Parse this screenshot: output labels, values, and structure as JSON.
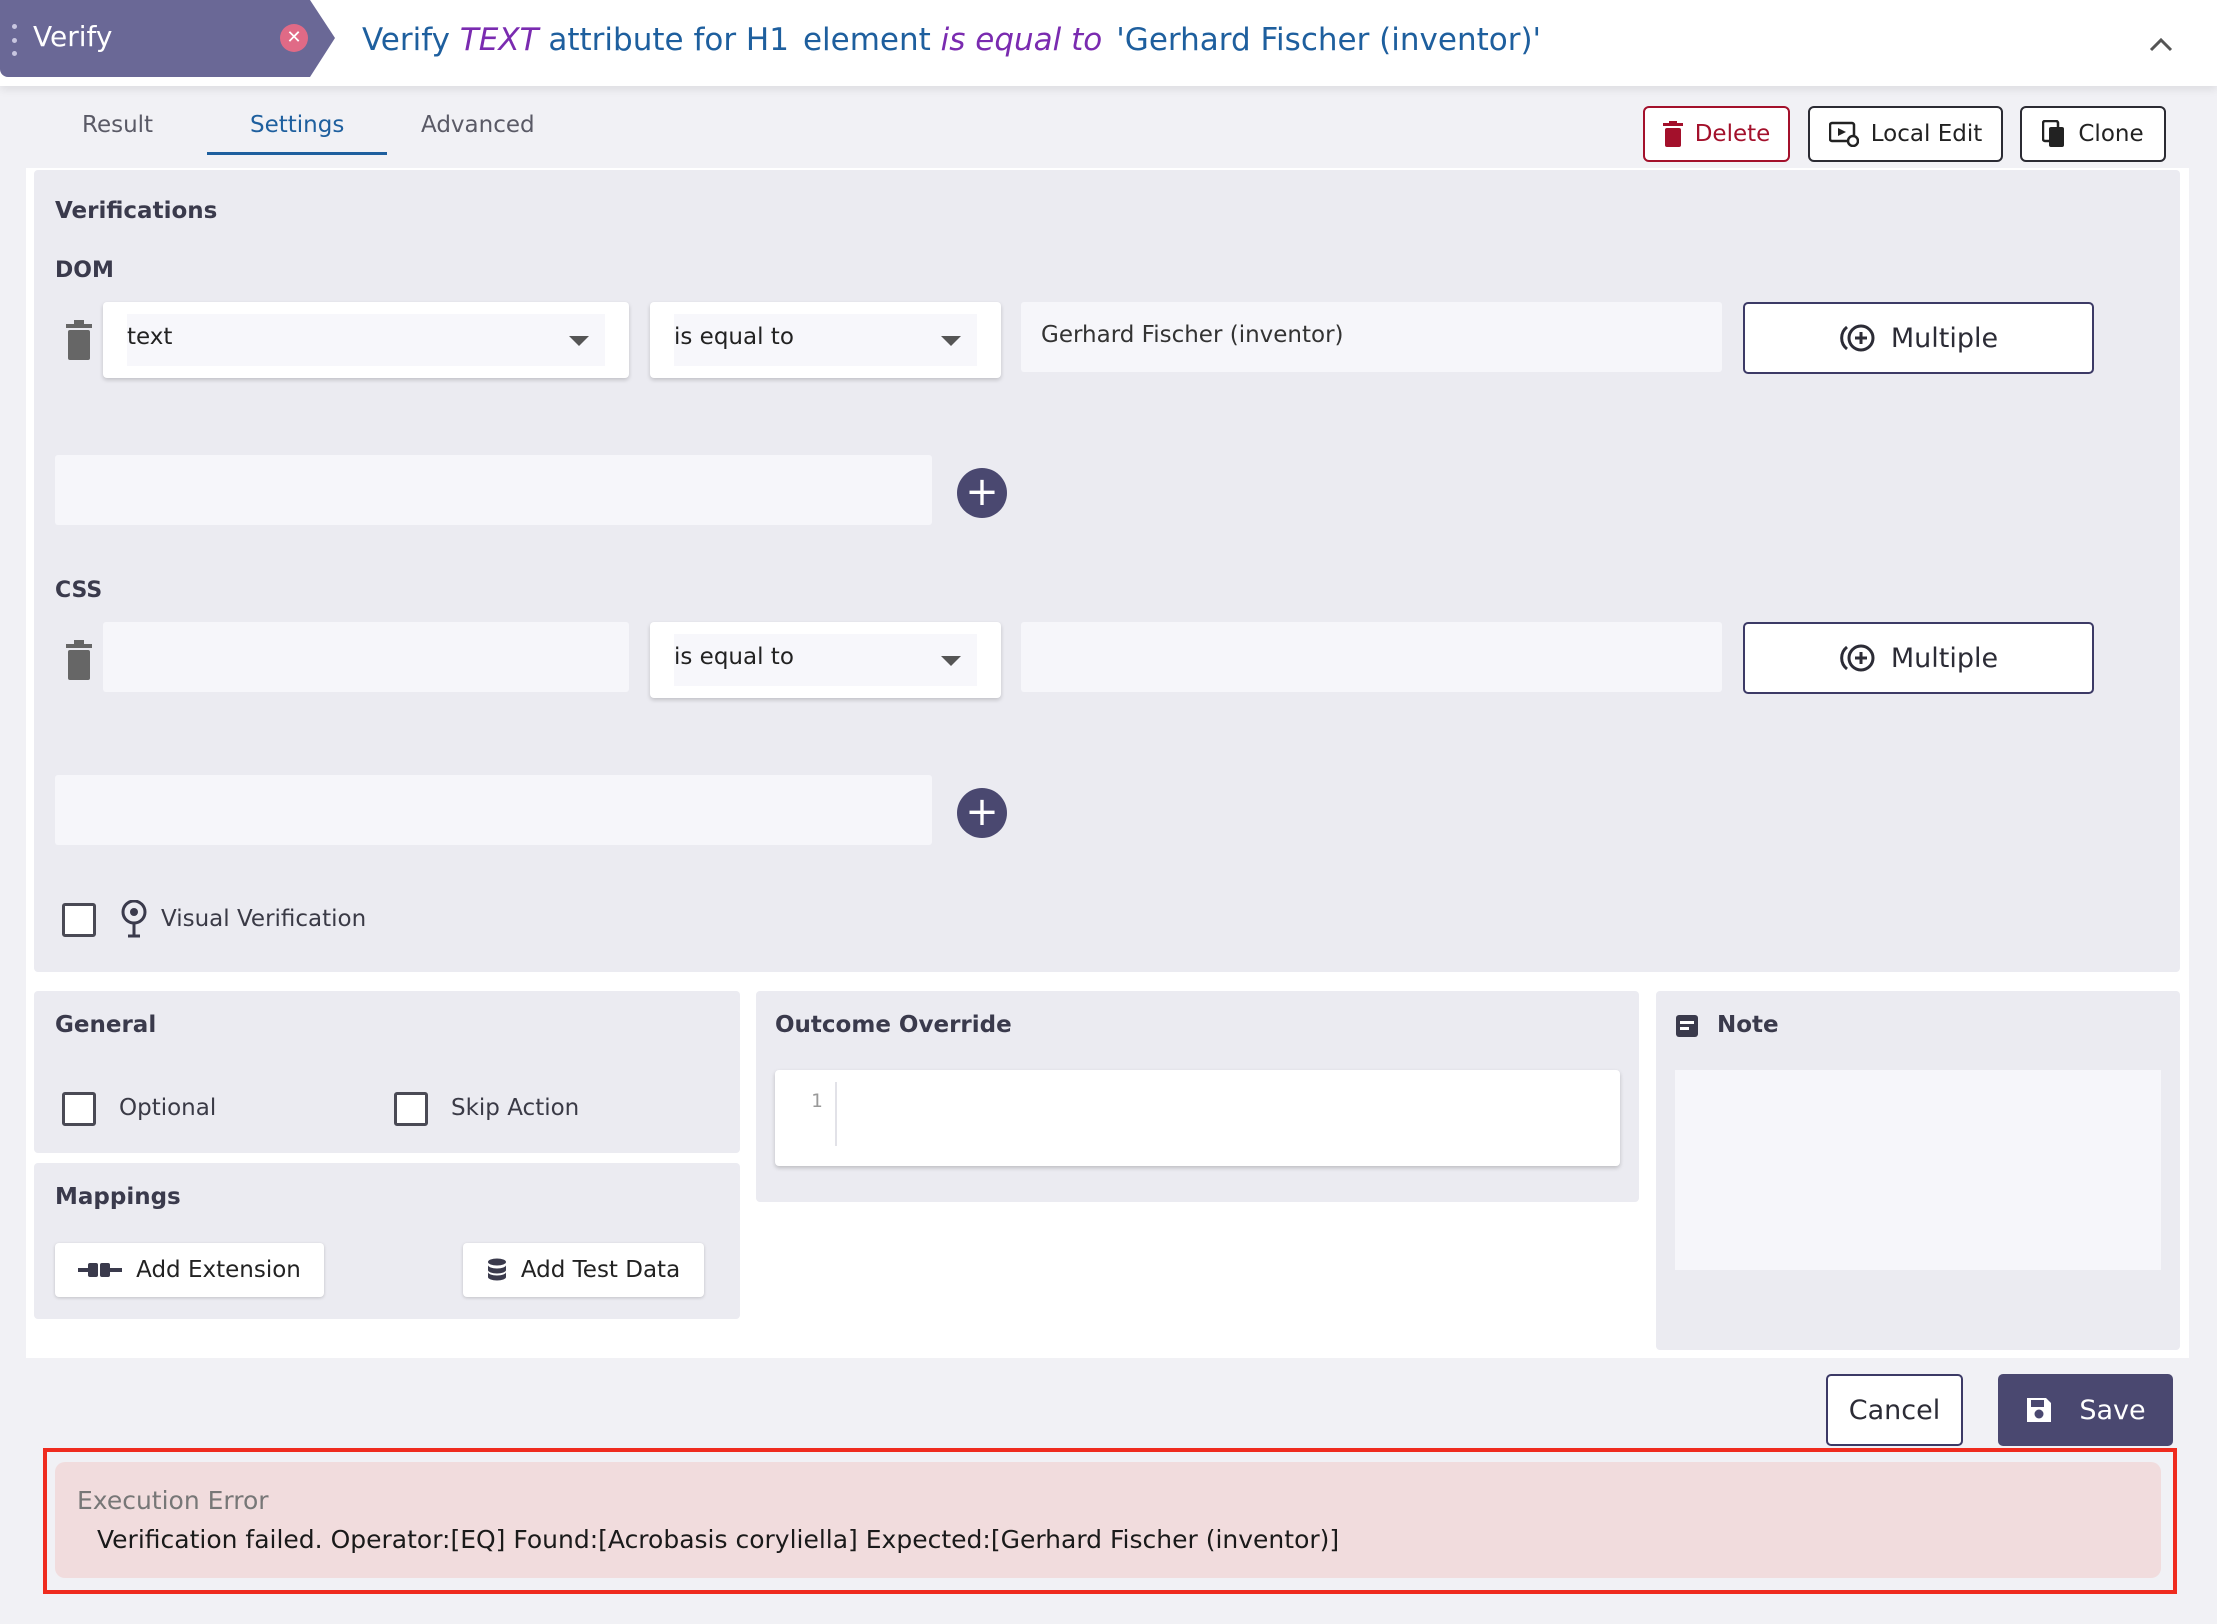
{
  "header": {
    "step_label": "Verify",
    "headline": {
      "prefix": "Verify",
      "attribute": "TEXT",
      "middle": "attribute for H1",
      "element_word": "element",
      "operator": "is equal to",
      "value": "'Gerhard Fischer (inventor)'"
    }
  },
  "tabs": [
    {
      "label": "Result",
      "active": false
    },
    {
      "label": "Settings",
      "active": true
    },
    {
      "label": "Advanced",
      "active": false
    }
  ],
  "toolbar": {
    "delete_label": "Delete",
    "local_edit_label": "Local Edit",
    "clone_label": "Clone"
  },
  "verifications": {
    "title": "Verifications",
    "dom": {
      "label": "DOM",
      "attribute": "text",
      "operator": "is equal to",
      "value": "Gerhard Fischer (inventor)",
      "multiple_label": "Multiple"
    },
    "css": {
      "label": "CSS",
      "attribute": "",
      "operator": "is equal to",
      "value": "",
      "multiple_label": "Multiple"
    },
    "visual_verification_label": "Visual Verification"
  },
  "general": {
    "title": "General",
    "optional_label": "Optional",
    "skip_action_label": "Skip Action"
  },
  "mappings": {
    "title": "Mappings",
    "add_extension_label": "Add Extension",
    "add_test_data_label": "Add Test Data"
  },
  "outcome_override": {
    "title": "Outcome Override",
    "line_number": "1"
  },
  "note": {
    "title": "Note"
  },
  "footer": {
    "cancel_label": "Cancel",
    "save_label": "Save"
  },
  "error": {
    "title": "Execution Error",
    "message": "Verification failed. Operator:[EQ] Found:[Acrobasis coryliella] Expected:[Gerhard Fischer (inventor)]"
  },
  "colors": {
    "accent": "#4a4870",
    "link_blue": "#1e5f9e",
    "keyword_purple": "#7a2bb0",
    "danger": "#a3102b",
    "error_outline": "#ef2b1e"
  }
}
